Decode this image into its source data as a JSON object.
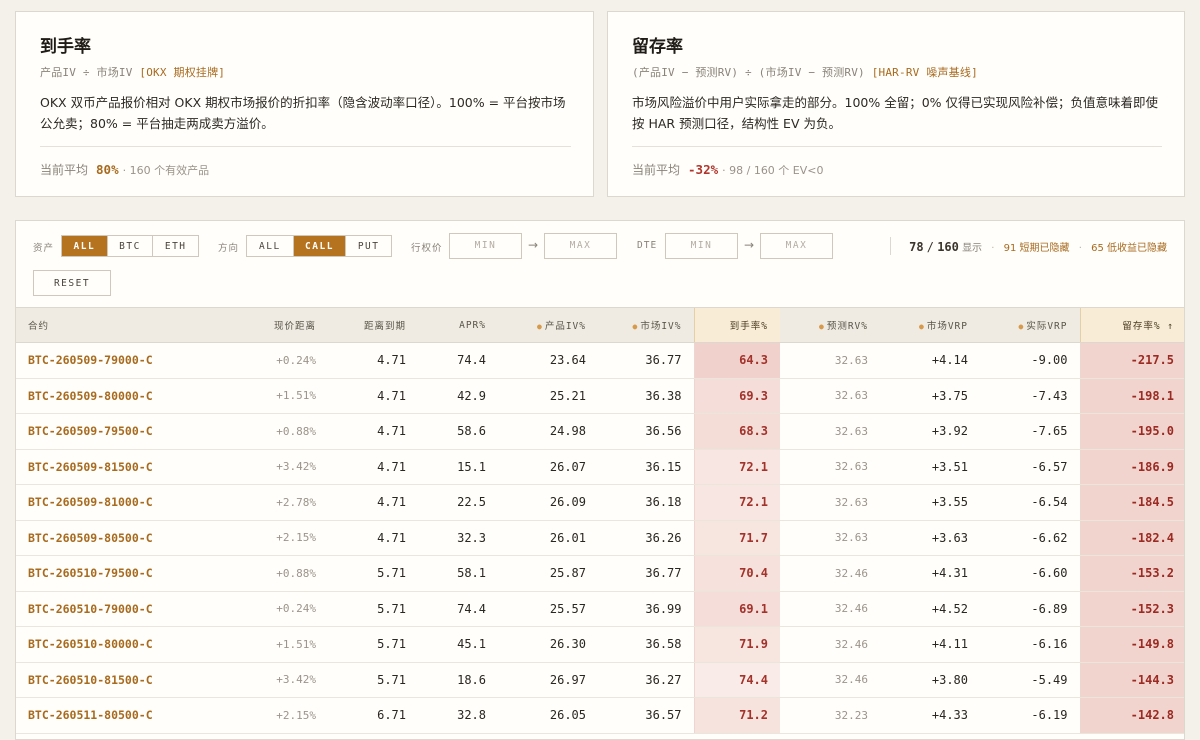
{
  "cards": {
    "conversion": {
      "title": "到手率",
      "formula": "产品IV ÷ 市场IV",
      "tag": "[OKX 期权挂牌]",
      "desc": "OKX 双币产品报价相对 OKX 期权市场报价的折扣率（隐含波动率口径）。100% = 平台按市场公允卖；80% = 平台抽走两成卖方溢价。",
      "stat_label": "当前平均",
      "stat_value": "80%",
      "stat_note": "· 160 个有效产品"
    },
    "retention": {
      "title": "留存率",
      "formula": "(产品IV − 预测RV) ÷ (市场IV − 预测RV)",
      "tag": "[HAR-RV 噪声基线]",
      "desc": "市场风险溢价中用户实际拿走的部分。100% 全留；0% 仅得已实现风险补偿；负值意味着即使按 HAR 预测口径，结构性 EV 为负。",
      "stat_label": "当前平均",
      "stat_value": "-32%",
      "stat_note": "· 98 / 160 个 EV<0"
    }
  },
  "filters": {
    "asset_label": "资产",
    "asset_options": [
      "ALL",
      "BTC",
      "ETH"
    ],
    "asset_selected": "ALL",
    "direction_label": "方向",
    "direction_options": [
      "ALL",
      "CALL",
      "PUT"
    ],
    "direction_selected": "CALL",
    "strike_label": "行权价",
    "strike_min_placeholder": "MIN",
    "strike_max_placeholder": "MAX",
    "dte_label": "DTE",
    "dte_min_placeholder": "MIN",
    "dte_max_placeholder": "MAX",
    "arrow": "→",
    "reset_label": "RESET"
  },
  "counts": {
    "shown": "78",
    "slash": "/",
    "total": "160",
    "shown_label": "显示",
    "short_hidden": "91 短期已隐藏",
    "low_hidden": "65 低收益已隐藏",
    "dot": "·"
  },
  "table": {
    "headers": [
      "合约",
      "现价距离",
      "距离到期",
      "APR%",
      "产品IV%",
      "市场IV%",
      "到手率%",
      "预测RV%",
      "市场VRP",
      "实际VRP",
      "留存率% ↑"
    ],
    "rows": [
      [
        "BTC-260509-79000-C",
        "+0.24%",
        "4.71",
        "74.4",
        "23.64",
        "36.77",
        "64.3",
        "32.63",
        "+4.14",
        "-9.00",
        "-217.5"
      ],
      [
        "BTC-260509-80000-C",
        "+1.51%",
        "4.71",
        "42.9",
        "25.21",
        "36.38",
        "69.3",
        "32.63",
        "+3.75",
        "-7.43",
        "-198.1"
      ],
      [
        "BTC-260509-79500-C",
        "+0.88%",
        "4.71",
        "58.6",
        "24.98",
        "36.56",
        "68.3",
        "32.63",
        "+3.92",
        "-7.65",
        "-195.0"
      ],
      [
        "BTC-260509-81500-C",
        "+3.42%",
        "4.71",
        "15.1",
        "26.07",
        "36.15",
        "72.1",
        "32.63",
        "+3.51",
        "-6.57",
        "-186.9"
      ],
      [
        "BTC-260509-81000-C",
        "+2.78%",
        "4.71",
        "22.5",
        "26.09",
        "36.18",
        "72.1",
        "32.63",
        "+3.55",
        "-6.54",
        "-184.5"
      ],
      [
        "BTC-260509-80500-C",
        "+2.15%",
        "4.71",
        "32.3",
        "26.01",
        "36.26",
        "71.7",
        "32.63",
        "+3.63",
        "-6.62",
        "-182.4"
      ],
      [
        "BTC-260510-79500-C",
        "+0.88%",
        "5.71",
        "58.1",
        "25.87",
        "36.77",
        "70.4",
        "32.46",
        "+4.31",
        "-6.60",
        "-153.2"
      ],
      [
        "BTC-260510-79000-C",
        "+0.24%",
        "5.71",
        "74.4",
        "25.57",
        "36.99",
        "69.1",
        "32.46",
        "+4.52",
        "-6.89",
        "-152.3"
      ],
      [
        "BTC-260510-80000-C",
        "+1.51%",
        "5.71",
        "45.1",
        "26.30",
        "36.58",
        "71.9",
        "32.46",
        "+4.11",
        "-6.16",
        "-149.8"
      ],
      [
        "BTC-260510-81500-C",
        "+3.42%",
        "5.71",
        "18.6",
        "26.97",
        "36.27",
        "74.4",
        "32.46",
        "+3.80",
        "-5.49",
        "-144.3"
      ],
      [
        "BTC-260511-80500-C",
        "+2.15%",
        "6.71",
        "32.8",
        "26.05",
        "36.57",
        "71.2",
        "32.23",
        "+4.33",
        "-6.19",
        "-142.8"
      ]
    ]
  }
}
